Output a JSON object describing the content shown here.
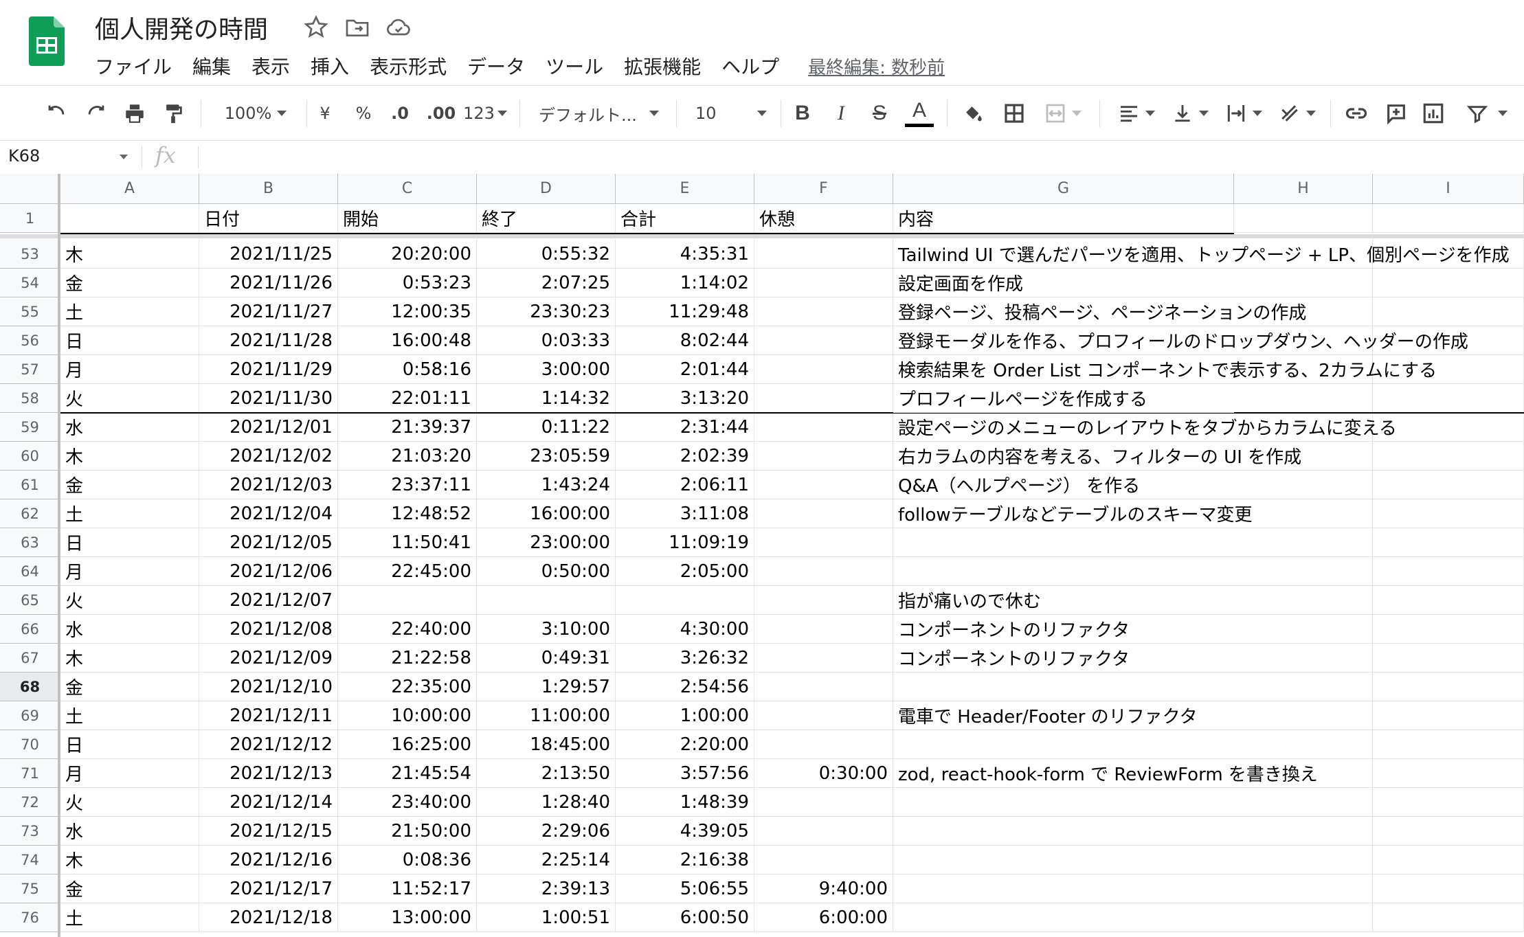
{
  "app": {
    "title": "個人開発の時間",
    "menus": [
      "ファイル",
      "編集",
      "表示",
      "挿入",
      "表示形式",
      "データ",
      "ツール",
      "拡張機能",
      "ヘルプ"
    ],
    "last_edit": "最終編集: 数秒前",
    "brand_color": "#0f9d58"
  },
  "toolbar": {
    "zoom": "100%",
    "currency": "¥",
    "percent": "%",
    "decrease_decimal": ".0",
    "increase_decimal": ".00",
    "more_formats": "123",
    "font": "デフォルト...",
    "font_size": "10",
    "icons": [
      "undo-icon",
      "redo-icon",
      "print-icon",
      "paint-format-icon",
      "bold-icon",
      "italic-icon",
      "strikethrough-icon",
      "text-color-icon",
      "fill-color-icon",
      "borders-icon",
      "merge-icon",
      "align-left-icon",
      "valign-bottom-icon",
      "text-wrap-icon",
      "text-rotate-icon",
      "link-icon",
      "comment-icon",
      "chart-icon",
      "filter-icon"
    ]
  },
  "formula_bar": {
    "cell_ref": "K68",
    "fx": "fx",
    "value": ""
  },
  "columns": [
    "A",
    "B",
    "C",
    "D",
    "E",
    "F",
    "G",
    "H",
    "I"
  ],
  "header_row": {
    "row": "1",
    "cells": [
      "",
      "日付",
      "開始",
      "終了",
      "合計",
      "休憩",
      "内容",
      "",
      ""
    ]
  },
  "rows": [
    {
      "n": "53",
      "A": "木",
      "B": "2021/11/25",
      "C": "20:20:00",
      "D": "0:55:32",
      "E": "4:35:31",
      "F": "",
      "G": "Tailwind UI で選んだパーツを適用、トップページ + LP、個別ページを作成"
    },
    {
      "n": "54",
      "A": "金",
      "B": "2021/11/26",
      "C": "0:53:23",
      "D": "2:07:25",
      "E": "1:14:02",
      "F": "",
      "G": "設定画面を作成"
    },
    {
      "n": "55",
      "A": "土",
      "B": "2021/11/27",
      "C": "12:00:35",
      "D": "23:30:23",
      "E": "11:29:48",
      "F": "",
      "G": "登録ページ、投稿ページ、ページネーションの作成"
    },
    {
      "n": "56",
      "A": "日",
      "B": "2021/11/28",
      "C": "16:00:48",
      "D": "0:03:33",
      "E": "8:02:44",
      "F": "",
      "G": "登録モーダルを作る、プロフィールのドロップダウン、ヘッダーの作成"
    },
    {
      "n": "57",
      "A": "月",
      "B": "2021/11/29",
      "C": "0:58:16",
      "D": "3:00:00",
      "E": "2:01:44",
      "F": "",
      "G": "検索結果を Order List コンポーネントで表示する、2カラムにする"
    },
    {
      "n": "58",
      "A": "火",
      "B": "2021/11/30",
      "C": "22:01:11",
      "D": "1:14:32",
      "E": "3:13:20",
      "F": "",
      "G": "プロフィールページを作成する"
    },
    {
      "n": "59",
      "A": "水",
      "B": "2021/12/01",
      "C": "21:39:37",
      "D": "0:11:22",
      "E": "2:31:44",
      "F": "",
      "G": "設定ページのメニューのレイアウトをタブからカラムに変える"
    },
    {
      "n": "60",
      "A": "木",
      "B": "2021/12/02",
      "C": "21:03:20",
      "D": "23:05:59",
      "E": "2:02:39",
      "F": "",
      "G": "右カラムの内容を考える、フィルターの UI を作成"
    },
    {
      "n": "61",
      "A": "金",
      "B": "2021/12/03",
      "C": "23:37:11",
      "D": "1:43:24",
      "E": "2:06:11",
      "F": "",
      "G": " Q&A（ヘルプページ） を作る"
    },
    {
      "n": "62",
      "A": "土",
      "B": "2021/12/04",
      "C": "12:48:52",
      "D": "16:00:00",
      "E": "3:11:08",
      "F": "",
      "G": "followテーブルなどテーブルのスキーマ変更"
    },
    {
      "n": "63",
      "A": "日",
      "B": "2021/12/05",
      "C": "11:50:41",
      "D": "23:00:00",
      "E": "11:09:19",
      "F": "",
      "G": ""
    },
    {
      "n": "64",
      "A": "月",
      "B": "2021/12/06",
      "C": "22:45:00",
      "D": "0:50:00",
      "E": "2:05:00",
      "F": "",
      "G": ""
    },
    {
      "n": "65",
      "A": "火",
      "B": "2021/12/07",
      "C": "",
      "D": "",
      "E": "",
      "F": "",
      "G": "指が痛いので休む"
    },
    {
      "n": "66",
      "A": "水",
      "B": "2021/12/08",
      "C": "22:40:00",
      "D": "3:10:00",
      "E": "4:30:00",
      "F": "",
      "G": "コンポーネントのリファクタ"
    },
    {
      "n": "67",
      "A": "木",
      "B": "2021/12/09",
      "C": "21:22:58",
      "D": "0:49:31",
      "E": "3:26:32",
      "F": "",
      "G": "コンポーネントのリファクタ"
    },
    {
      "n": "68",
      "A": "金",
      "B": "2021/12/10",
      "C": "22:35:00",
      "D": "1:29:57",
      "E": "2:54:56",
      "F": "",
      "G": ""
    },
    {
      "n": "69",
      "A": "土",
      "B": "2021/12/11",
      "C": "10:00:00",
      "D": "11:00:00",
      "E": "1:00:00",
      "F": "",
      "G": "電車で Header/Footer のリファクタ"
    },
    {
      "n": "70",
      "A": "日",
      "B": "2021/12/12",
      "C": "16:25:00",
      "D": "18:45:00",
      "E": "2:20:00",
      "F": "",
      "G": ""
    },
    {
      "n": "71",
      "A": "月",
      "B": "2021/12/13",
      "C": "21:45:54",
      "D": "2:13:50",
      "E": "3:57:56",
      "F": "0:30:00",
      "G": "zod, react-hook-form で ReviewForm を書き換え"
    },
    {
      "n": "72",
      "A": "火",
      "B": "2021/12/14",
      "C": "23:40:00",
      "D": "1:28:40",
      "E": "1:48:39",
      "F": "",
      "G": ""
    },
    {
      "n": "73",
      "A": "水",
      "B": "2021/12/15",
      "C": "21:50:00",
      "D": "2:29:06",
      "E": "4:39:05",
      "F": "",
      "G": ""
    },
    {
      "n": "74",
      "A": "木",
      "B": "2021/12/16",
      "C": "0:08:36",
      "D": "2:25:14",
      "E": "2:16:38",
      "F": "",
      "G": ""
    },
    {
      "n": "75",
      "A": "金",
      "B": "2021/12/17",
      "C": "11:52:17",
      "D": "2:39:13",
      "E": "5:06:55",
      "F": "9:40:00",
      "G": ""
    },
    {
      "n": "76",
      "A": "土",
      "B": "2021/12/18",
      "C": "13:00:00",
      "D": "1:00:51",
      "E": "6:00:50",
      "F": "6:00:00",
      "G": ""
    }
  ],
  "active_row": "68"
}
